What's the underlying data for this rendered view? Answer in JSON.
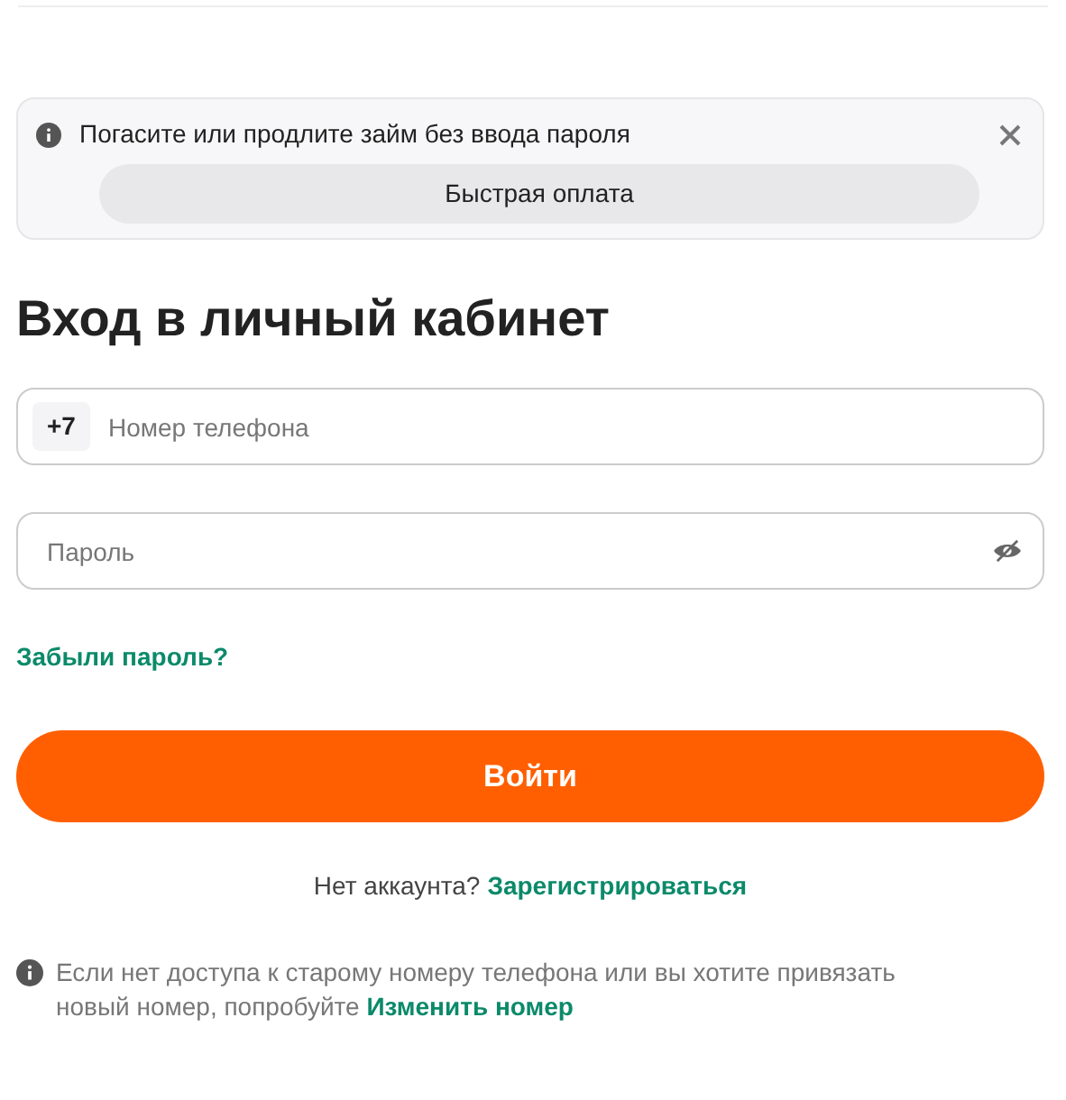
{
  "banner": {
    "message": "Погасите или продлите займ без ввода пароля",
    "button": "Быстрая оплата"
  },
  "title": "Вход в личный кабинет",
  "phone": {
    "prefix": "+7",
    "placeholder": "Номер телефона"
  },
  "password": {
    "placeholder": "Пароль"
  },
  "forgot_link": "Забыли пароль?",
  "submit": "Войти",
  "register": {
    "text": "Нет аккаунта?",
    "link": "Зарегистрироваться"
  },
  "note": {
    "text": "Если нет доступа к старому номеру телефона или вы хотите привязать новый номер, попробуйте",
    "link": "Изменить номер"
  }
}
